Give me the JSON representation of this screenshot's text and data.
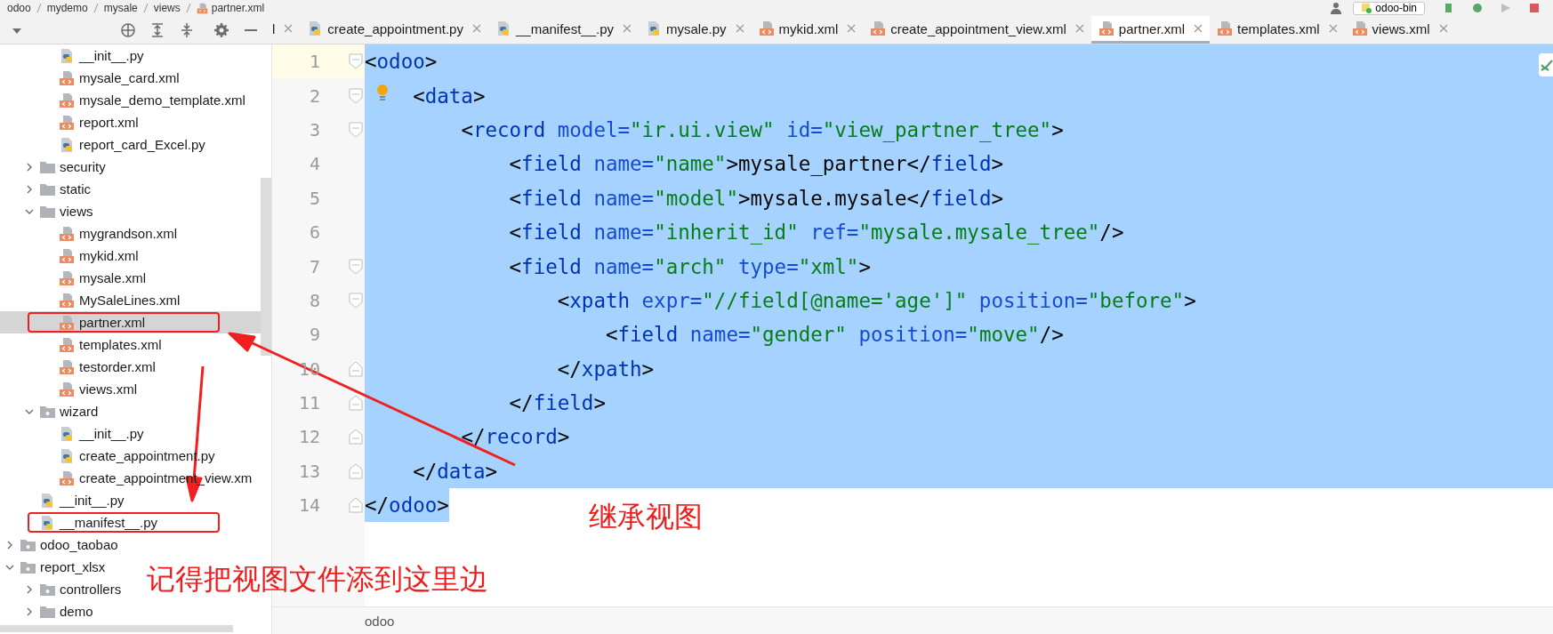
{
  "breadcrumb": [
    {
      "label": "odoo",
      "kind": "folder"
    },
    {
      "label": "mydemo",
      "kind": "folder"
    },
    {
      "label": "mysale",
      "kind": "folder"
    },
    {
      "label": "views",
      "kind": "folder"
    },
    {
      "label": "partner.xml",
      "kind": "xml"
    }
  ],
  "run_config": {
    "label": "odoo-bin"
  },
  "tabs": [
    {
      "label": "l",
      "kind": "cut",
      "selected": false
    },
    {
      "label": "create_appointment.py",
      "kind": "py",
      "selected": false
    },
    {
      "label": "__manifest__.py",
      "kind": "py",
      "selected": false
    },
    {
      "label": "mysale.py",
      "kind": "py",
      "selected": false
    },
    {
      "label": "mykid.xml",
      "kind": "xml",
      "selected": false
    },
    {
      "label": "create_appointment_view.xml",
      "kind": "xml",
      "selected": false
    },
    {
      "label": "partner.xml",
      "kind": "xml",
      "selected": true
    },
    {
      "label": "templates.xml",
      "kind": "xml",
      "selected": false
    },
    {
      "label": "views.xml",
      "kind": "xml",
      "selected": false
    }
  ],
  "project_tree": [
    {
      "children": [
        {
          "children": [
            {
              "name": "__init__.py",
              "kind": "py",
              "selected": false,
              "boxed": false
            },
            {
              "name": "mysale_card.xml",
              "kind": "xml",
              "selected": false,
              "boxed": false
            },
            {
              "name": "mysale_demo_template.xml",
              "kind": "xml",
              "selected": false,
              "boxed": false
            },
            {
              "name": "report.xml",
              "kind": "xml",
              "selected": false,
              "boxed": false
            },
            {
              "name": "report_card_Excel.py",
              "kind": "py",
              "selected": false,
              "boxed": false
            }
          ]
        },
        {
          "name": "security",
          "kind": "folder",
          "expanded": false,
          "selected": false,
          "boxed": false
        },
        {
          "name": "static",
          "kind": "folder",
          "expanded": false,
          "selected": false,
          "boxed": false
        },
        {
          "name": "views",
          "kind": "folder",
          "expanded": true,
          "selected": false,
          "boxed": false,
          "children": [
            {
              "name": "mygrandson.xml",
              "kind": "xml",
              "selected": false,
              "boxed": false
            },
            {
              "name": "mykid.xml",
              "kind": "xml",
              "selected": false,
              "boxed": false
            },
            {
              "name": "mysale.xml",
              "kind": "xml",
              "selected": false,
              "boxed": false
            },
            {
              "name": "MySaleLines.xml",
              "kind": "xml",
              "selected": false,
              "boxed": false
            },
            {
              "name": "partner.xml",
              "kind": "xml",
              "selected": true,
              "boxed": true
            },
            {
              "name": "templates.xml",
              "kind": "xml",
              "selected": false,
              "boxed": false
            },
            {
              "name": "testorder.xml",
              "kind": "xml",
              "selected": false,
              "boxed": false
            },
            {
              "name": "views.xml",
              "kind": "xml",
              "selected": false,
              "boxed": false
            }
          ]
        },
        {
          "name": "wizard",
          "kind": "package",
          "expanded": true,
          "selected": false,
          "boxed": false,
          "children": [
            {
              "name": "__init__.py",
              "kind": "py",
              "selected": false,
              "boxed": false
            },
            {
              "name": "create_appointment.py",
              "kind": "py",
              "selected": false,
              "boxed": false
            },
            {
              "name": "create_appointment_view.xm",
              "kind": "xml",
              "selected": false,
              "boxed": false
            }
          ]
        },
        {
          "name": "__init__.py",
          "kind": "py",
          "selected": false,
          "boxed": false
        },
        {
          "name": "__manifest__.py",
          "kind": "py",
          "selected": false,
          "boxed": true
        }
      ]
    },
    {
      "name": "odoo_taobao",
      "kind": "package",
      "expanded": false,
      "selected": false,
      "boxed": false
    },
    {
      "name": "report_xlsx",
      "kind": "package",
      "expanded": true,
      "selected": false,
      "boxed": false,
      "children": [
        {
          "name": "controllers",
          "kind": "package",
          "expanded": false,
          "selected": false,
          "boxed": false
        },
        {
          "name": "demo",
          "kind": "folder",
          "expanded": false,
          "selected": false,
          "boxed": false
        }
      ]
    }
  ],
  "editor": {
    "lines": [
      {
        "number": "1",
        "current": true,
        "selected": true,
        "bulb": false,
        "fold_start": true,
        "fold_end": false,
        "tokens": [
          {
            "kind": "punct",
            "text": "<"
          },
          {
            "kind": "tag",
            "text": "odoo"
          },
          {
            "kind": "punct",
            "text": ">"
          }
        ]
      },
      {
        "number": "2",
        "current": false,
        "selected": true,
        "bulb": true,
        "fold_start": true,
        "fold_end": false,
        "tokens": [
          {
            "kind": "punct",
            "text": "    <"
          },
          {
            "kind": "tag",
            "text": "data"
          },
          {
            "kind": "punct",
            "text": ">"
          }
        ]
      },
      {
        "number": "3",
        "current": false,
        "selected": true,
        "bulb": false,
        "fold_start": true,
        "fold_end": false,
        "tokens": [
          {
            "kind": "punct",
            "text": "        <"
          },
          {
            "kind": "tag",
            "text": "record"
          },
          {
            "kind": "attr",
            "text": " model="
          },
          {
            "kind": "value",
            "text": "\"ir.ui.view\""
          },
          {
            "kind": "attr",
            "text": " id="
          },
          {
            "kind": "value",
            "text": "\"view_partner_tree\""
          },
          {
            "kind": "punct",
            "text": ">"
          }
        ]
      },
      {
        "number": "4",
        "current": false,
        "selected": true,
        "bulb": false,
        "fold_start": false,
        "fold_end": false,
        "tokens": [
          {
            "kind": "punct",
            "text": "            <"
          },
          {
            "kind": "tag",
            "text": "field"
          },
          {
            "kind": "attr",
            "text": " name="
          },
          {
            "kind": "value",
            "text": "\"name\""
          },
          {
            "kind": "punct",
            "text": ">"
          },
          {
            "kind": "text",
            "text": "mysale_partner"
          },
          {
            "kind": "punct",
            "text": "</"
          },
          {
            "kind": "tag",
            "text": "field"
          },
          {
            "kind": "punct",
            "text": ">"
          }
        ]
      },
      {
        "number": "5",
        "current": false,
        "selected": true,
        "bulb": false,
        "fold_start": false,
        "fold_end": false,
        "tokens": [
          {
            "kind": "punct",
            "text": "            <"
          },
          {
            "kind": "tag",
            "text": "field"
          },
          {
            "kind": "attr",
            "text": " name="
          },
          {
            "kind": "value",
            "text": "\"model\""
          },
          {
            "kind": "punct",
            "text": ">"
          },
          {
            "kind": "text",
            "text": "mysale.mysale"
          },
          {
            "kind": "punct",
            "text": "</"
          },
          {
            "kind": "tag",
            "text": "field"
          },
          {
            "kind": "punct",
            "text": ">"
          }
        ]
      },
      {
        "number": "6",
        "current": false,
        "selected": true,
        "bulb": false,
        "fold_start": false,
        "fold_end": false,
        "tokens": [
          {
            "kind": "punct",
            "text": "            <"
          },
          {
            "kind": "tag",
            "text": "field"
          },
          {
            "kind": "attr",
            "text": " name="
          },
          {
            "kind": "value",
            "text": "\"inherit_id\""
          },
          {
            "kind": "attr",
            "text": " ref="
          },
          {
            "kind": "value",
            "text": "\"mysale.mysale_tree\""
          },
          {
            "kind": "punct",
            "text": "/>"
          }
        ]
      },
      {
        "number": "7",
        "current": false,
        "selected": true,
        "bulb": false,
        "fold_start": true,
        "fold_end": false,
        "tokens": [
          {
            "kind": "punct",
            "text": "            <"
          },
          {
            "kind": "tag",
            "text": "field"
          },
          {
            "kind": "attr",
            "text": " name="
          },
          {
            "kind": "value",
            "text": "\"arch\""
          },
          {
            "kind": "attr",
            "text": " type="
          },
          {
            "kind": "value",
            "text": "\"xml\""
          },
          {
            "kind": "punct",
            "text": ">"
          }
        ]
      },
      {
        "number": "8",
        "current": false,
        "selected": true,
        "bulb": false,
        "fold_start": true,
        "fold_end": false,
        "tokens": [
          {
            "kind": "punct",
            "text": "                <"
          },
          {
            "kind": "tag",
            "text": "xpath"
          },
          {
            "kind": "attr",
            "text": " expr="
          },
          {
            "kind": "value",
            "text": "\"//field[@name='age']\""
          },
          {
            "kind": "attr",
            "text": " position="
          },
          {
            "kind": "value",
            "text": "\"before\""
          },
          {
            "kind": "punct",
            "text": ">"
          }
        ]
      },
      {
        "number": "9",
        "current": false,
        "selected": true,
        "bulb": false,
        "fold_start": false,
        "fold_end": false,
        "tokens": [
          {
            "kind": "punct",
            "text": "                    <"
          },
          {
            "kind": "tag",
            "text": "field"
          },
          {
            "kind": "attr",
            "text": " name="
          },
          {
            "kind": "value",
            "text": "\"gender\""
          },
          {
            "kind": "attr",
            "text": " position="
          },
          {
            "kind": "value",
            "text": "\"move\""
          },
          {
            "kind": "punct",
            "text": "/>"
          }
        ]
      },
      {
        "number": "10",
        "current": false,
        "selected": true,
        "bulb": false,
        "fold_start": false,
        "fold_end": true,
        "tokens": [
          {
            "kind": "punct",
            "text": "                </"
          },
          {
            "kind": "tag",
            "text": "xpath"
          },
          {
            "kind": "punct",
            "text": ">"
          }
        ]
      },
      {
        "number": "11",
        "current": false,
        "selected": true,
        "bulb": false,
        "fold_start": false,
        "fold_end": true,
        "tokens": [
          {
            "kind": "punct",
            "text": "            </"
          },
          {
            "kind": "tag",
            "text": "field"
          },
          {
            "kind": "punct",
            "text": ">"
          }
        ]
      },
      {
        "number": "12",
        "current": false,
        "selected": true,
        "bulb": false,
        "fold_start": false,
        "fold_end": true,
        "tokens": [
          {
            "kind": "punct",
            "text": "        </"
          },
          {
            "kind": "tag",
            "text": "record"
          },
          {
            "kind": "punct",
            "text": ">"
          }
        ]
      },
      {
        "number": "13",
        "current": false,
        "selected": true,
        "bulb": false,
        "fold_start": false,
        "fold_end": true,
        "tokens": [
          {
            "kind": "punct",
            "text": "    </"
          },
          {
            "kind": "tag",
            "text": "data"
          },
          {
            "kind": "punct",
            "text": ">"
          }
        ]
      },
      {
        "number": "14",
        "current": false,
        "selected": true,
        "bulb": false,
        "fold_start": false,
        "fold_end": true,
        "tokens": [
          {
            "kind": "punct",
            "text": "</"
          },
          {
            "kind": "tag",
            "text": "odoo"
          },
          {
            "kind": "punct",
            "text": ">"
          }
        ]
      }
    ],
    "path_bar": "odoo"
  },
  "annotations": [
    {
      "text": "继承视图"
    },
    {
      "text": "记得把视图文件添到这里边"
    }
  ]
}
